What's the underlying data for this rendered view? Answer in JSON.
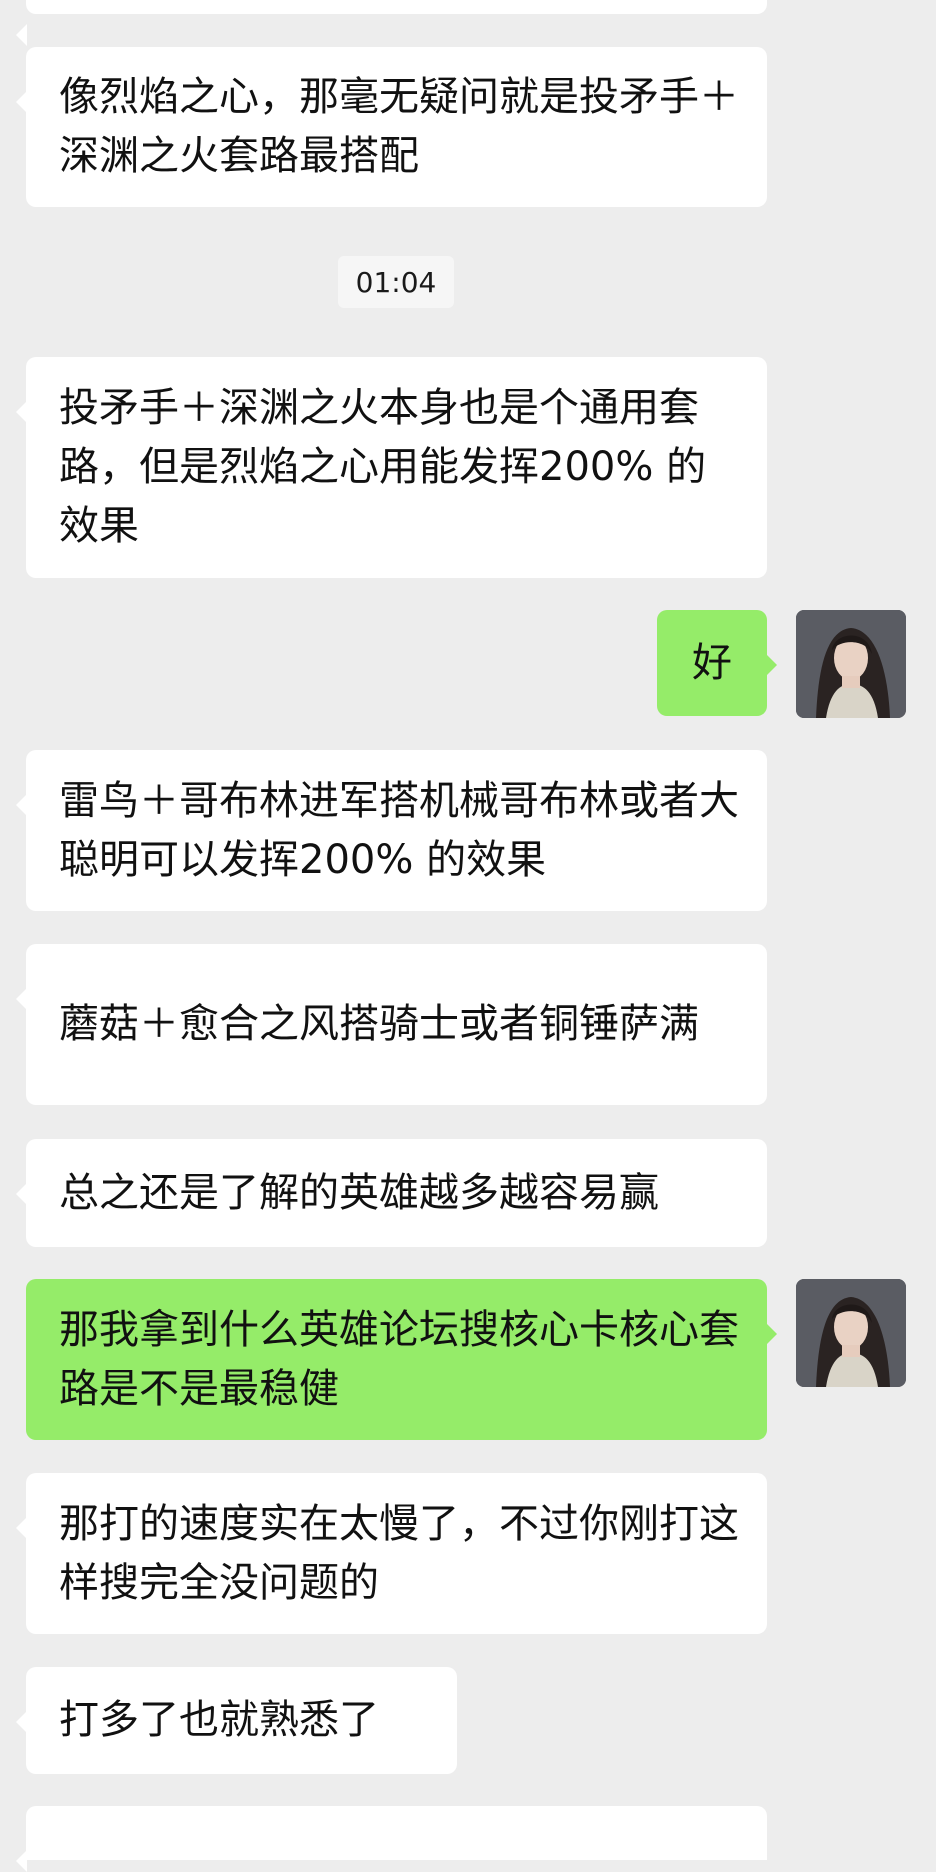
{
  "chat": {
    "timestamp": "01:04",
    "messages": [
      {
        "side": "in",
        "text": ""
      },
      {
        "side": "in",
        "text": "像烈焰之心，那毫无疑问就是投矛手＋深渊之火套路最搭配"
      },
      {
        "side": "in",
        "text": "投矛手＋深渊之火本身也是个通用套路，但是烈焰之心用能发挥200% 的效果"
      },
      {
        "side": "out",
        "text": "好"
      },
      {
        "side": "in",
        "text": "雷鸟＋哥布林进军搭机械哥布林或者大聪明可以发挥200% 的效果"
      },
      {
        "side": "in",
        "text": "蘑菇＋愈合之风搭骑士或者铜锤萨满"
      },
      {
        "side": "in",
        "text": "总之还是了解的英雄越多越容易赢"
      },
      {
        "side": "out",
        "text": "那我拿到什么英雄论坛搜核心卡核心套路是不是最稳健"
      },
      {
        "side": "in",
        "text": "那打的速度实在太慢了，不过你刚打这样搜完全没问题的"
      },
      {
        "side": "in",
        "text": "打多了也就熟悉了"
      },
      {
        "side": "in",
        "text": ""
      }
    ]
  },
  "icons": {
    "avatar": "avatar-photo-icon"
  },
  "colors": {
    "background": "#ededed",
    "incoming_bubble": "#ffffff",
    "outgoing_bubble": "#95ec69"
  }
}
